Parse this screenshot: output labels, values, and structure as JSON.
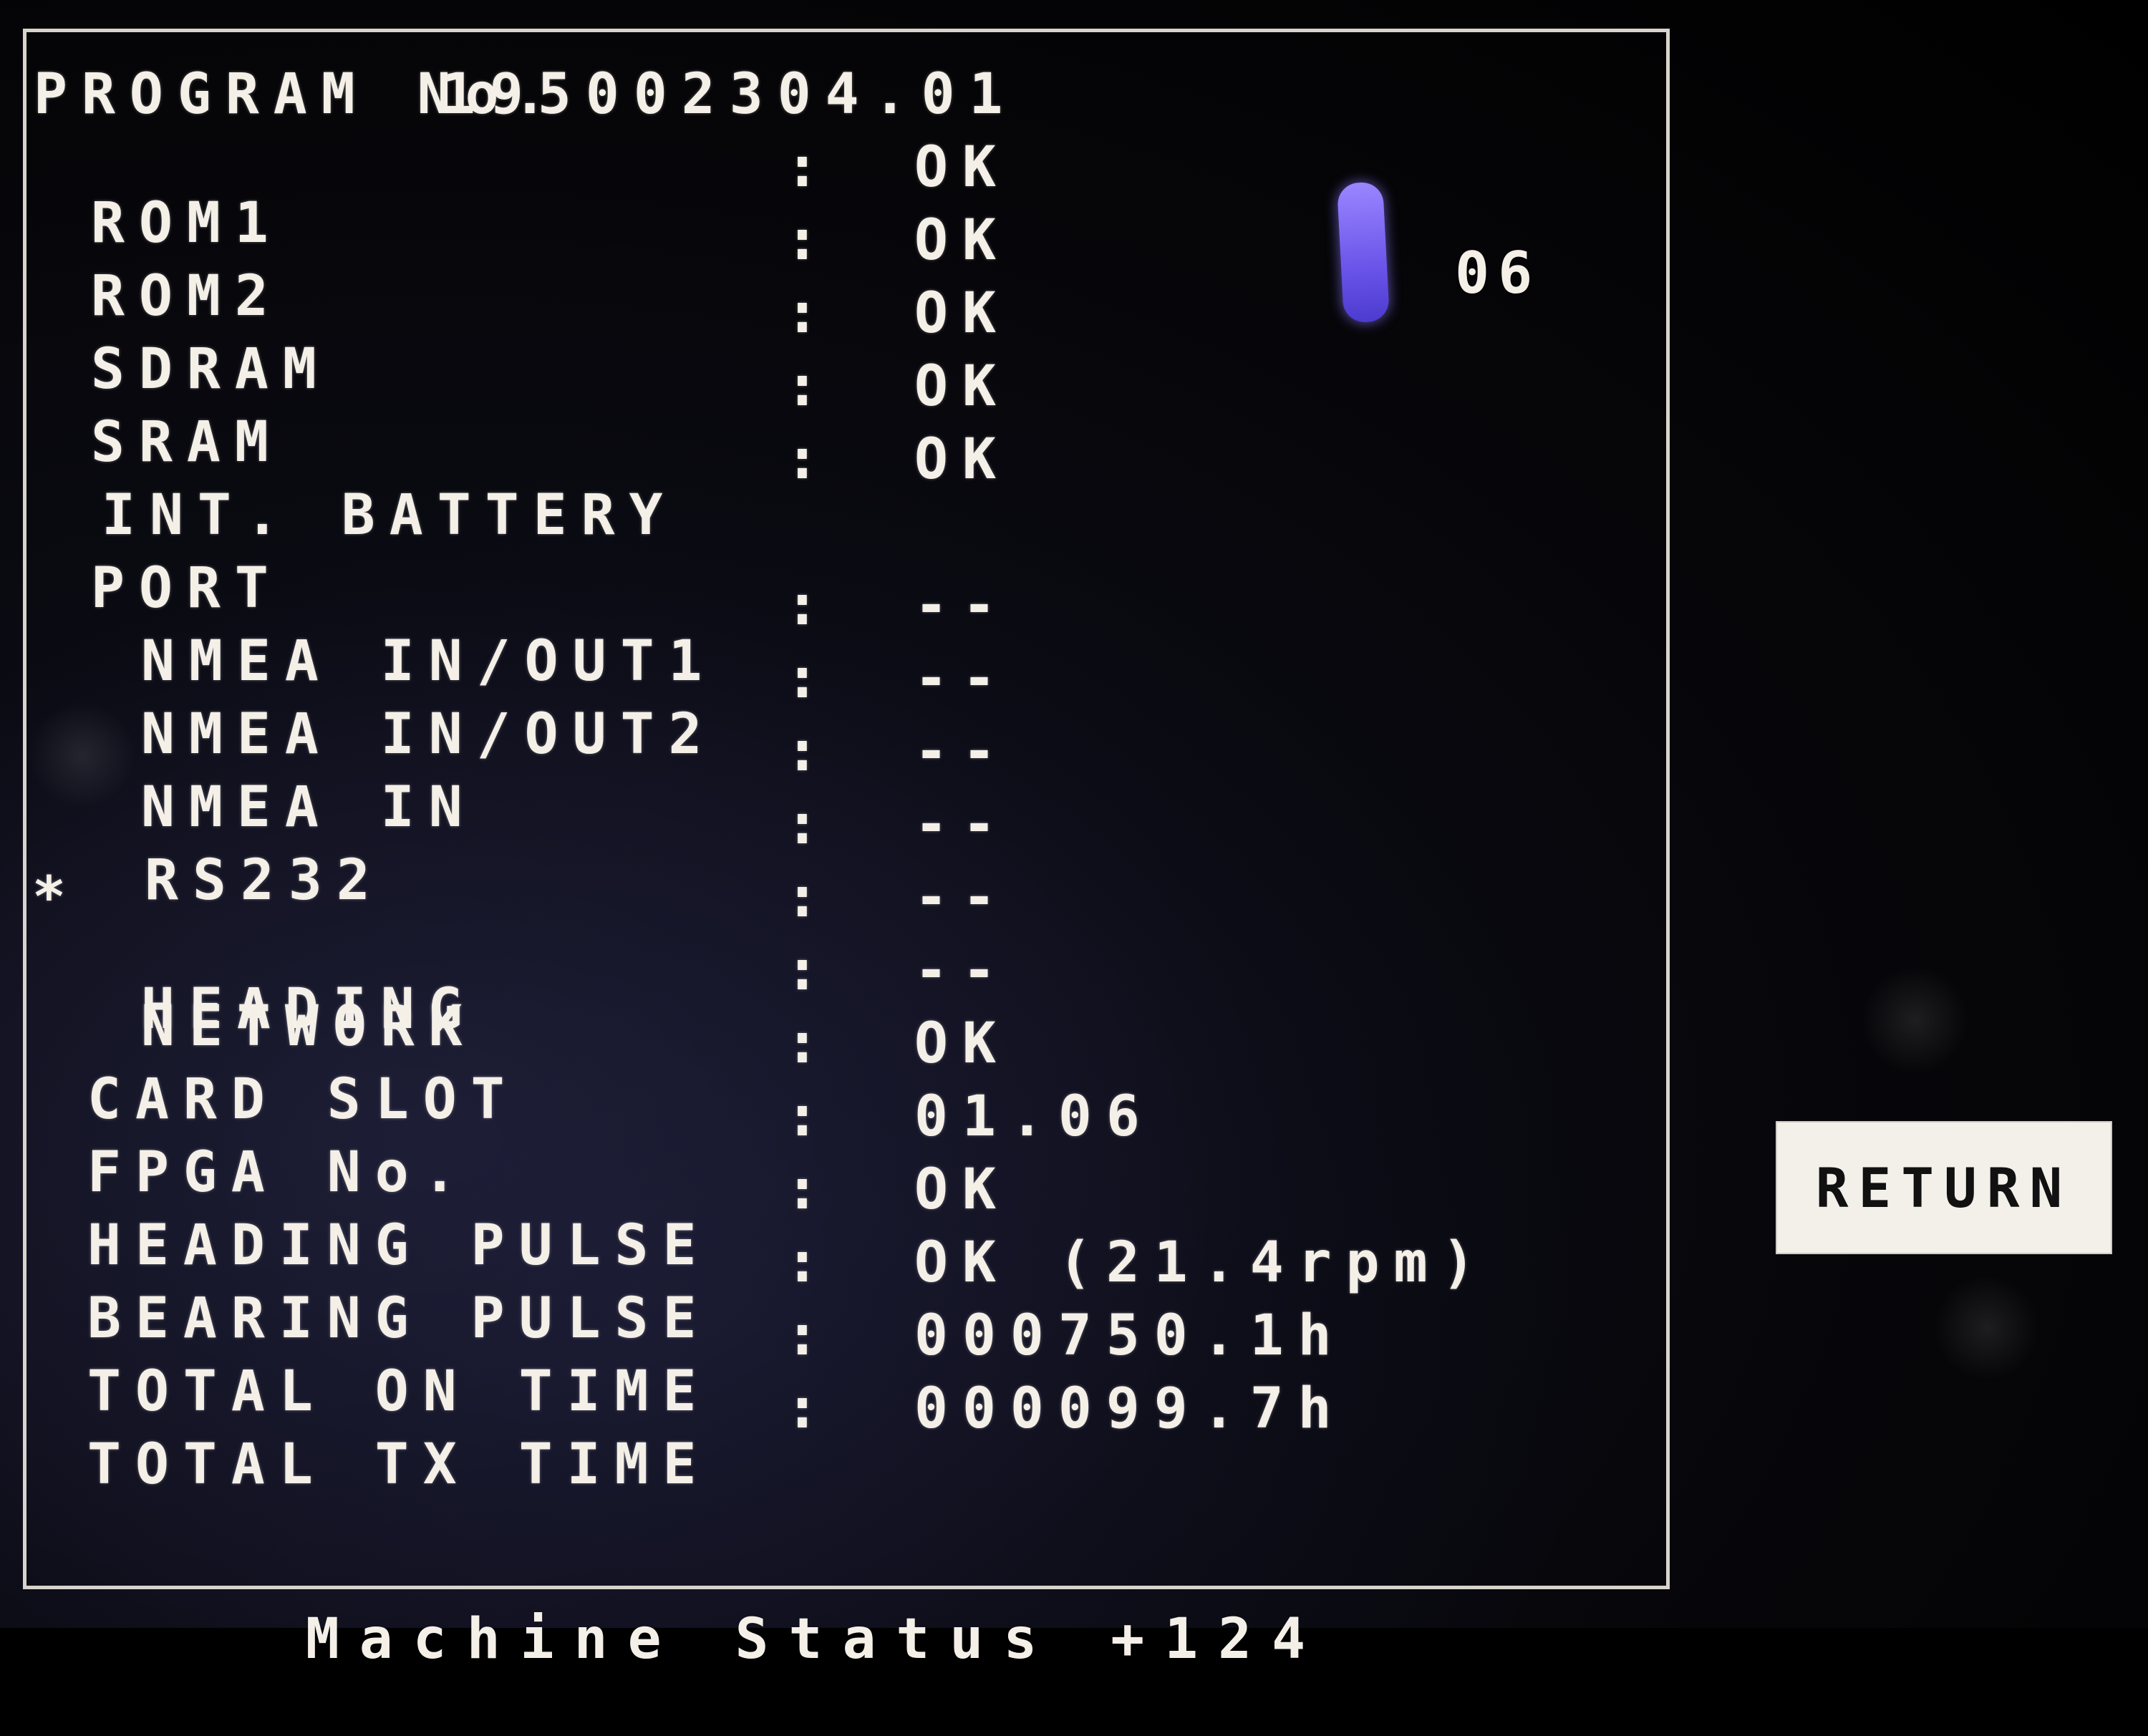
{
  "program": {
    "label": "PROGRAM No.",
    "number": "195002304.01"
  },
  "counter": "06",
  "rows": [
    {
      "label": "ROM1",
      "colon": ":",
      "value": "OK"
    },
    {
      "label": "ROM2",
      "colon": ":",
      "value": "OK"
    },
    {
      "label": "SDRAM",
      "colon": ":",
      "value": "OK"
    },
    {
      "label": "SRAM",
      "colon": ":",
      "value": "OK"
    },
    {
      "label": "INT. BATTERY",
      "colon": ":",
      "value": "OK"
    },
    {
      "label": "PORT",
      "colon": "",
      "value": ""
    },
    {
      "label": "NMEA IN/OUT1",
      "colon": ":",
      "value": "--"
    },
    {
      "label": "NMEA IN/OUT2",
      "colon": ":",
      "value": "--"
    },
    {
      "label": "NMEA IN",
      "colon": ":",
      "value": "--"
    },
    {
      "label": "RS232",
      "colon": ":",
      "value": "--"
    },
    {
      "label": "HEADING",
      "colon": ":",
      "value": "--",
      "marker": "*"
    },
    {
      "label": "NETWORK",
      "colon": ":",
      "value": "--"
    },
    {
      "label": "CARD SLOT",
      "colon": ":",
      "value": "OK"
    },
    {
      "label": "FPGA No.",
      "colon": ":",
      "value": "01.06"
    },
    {
      "label": "HEADING PULSE",
      "colon": ":",
      "value": "OK"
    },
    {
      "label": "BEARING PULSE",
      "colon": ":",
      "value": "OK (21.4rpm)"
    },
    {
      "label": "TOTAL ON TIME",
      "colon": ":",
      "value": "000750.1h"
    },
    {
      "label": "TOTAL TX TIME",
      "colon": ":",
      "value": "000099.7h"
    }
  ],
  "machine_status": {
    "label": "Machine Status",
    "value": "+124"
  },
  "buttons": {
    "return_label": "RETURN"
  },
  "colors": {
    "background": "#000000",
    "text": "#f4f0e8",
    "panel_border": "#d8d4cc",
    "button_bg": "#f3f0ea",
    "button_text": "#111111"
  }
}
